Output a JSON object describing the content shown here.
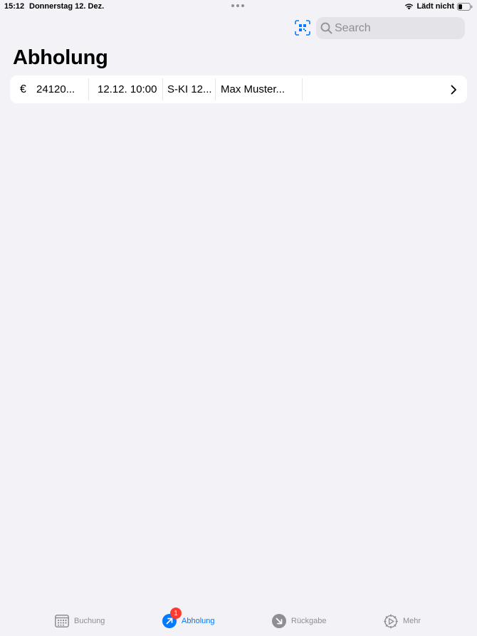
{
  "status_bar": {
    "time": "15:12",
    "date": "Donnerstag 12. Dez.",
    "charging": "Lädt nicht"
  },
  "toolbar": {
    "scan_icon": "qr-scan-icon",
    "search_placeholder": "Search"
  },
  "page": {
    "title": "Abholung"
  },
  "rows": [
    {
      "icon": "euro-icon",
      "icon_glyph": "€",
      "number": "24120...",
      "datetime": "12.12. 10:00",
      "plate": "S-KI 12...",
      "customer": "Max Muster..."
    }
  ],
  "tabs": [
    {
      "label": "Buchung",
      "icon": "calendar-icon",
      "active": false
    },
    {
      "label": "Abholung",
      "icon": "pickup-arrow-icon",
      "active": true,
      "badge": "1"
    },
    {
      "label": "Rückgabe",
      "icon": "return-arrow-icon",
      "active": false
    },
    {
      "label": "Mehr",
      "icon": "gear-icon",
      "active": false
    }
  ],
  "colors": {
    "accent": "#007aff",
    "badge": "#ff3b30",
    "inactive": "#8e8e93",
    "background": "#f2f2f7"
  }
}
